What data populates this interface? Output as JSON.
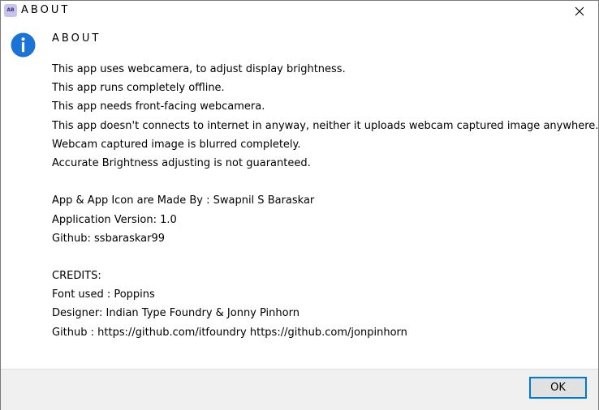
{
  "window": {
    "icon_text": "AB",
    "title": "ABOUT"
  },
  "dialog": {
    "heading": "ABOUT",
    "icon": "info-icon",
    "lines": [
      "This app uses webcamera, to adjust display brightness.",
      "This app runs completely offline.",
      "This app needs front-facing webcamera.",
      "This app doesn't connects to internet in anyway, neither it uploads webcam captured image anywhere.",
      "Webcam captured image is blurred completely.",
      "Accurate Brightness adjusting is not guaranteed.",
      "",
      "App & App Icon are Made By : Swapnil S Baraskar",
      "Application Version: 1.0",
      "Github: ssbaraskar99",
      "",
      "CREDITS:",
      "Font used : Poppins",
      "Designer: Indian Type Foundry & Jonny Pinhorn",
      "Github : https://github.com/itfoundry https://github.com/jonpinhorn"
    ]
  },
  "footer": {
    "ok_label": "OK"
  },
  "colors": {
    "info_blue": "#1a73d6",
    "focus_border": "#0078d7",
    "footer_bg": "#f0f0f0"
  }
}
